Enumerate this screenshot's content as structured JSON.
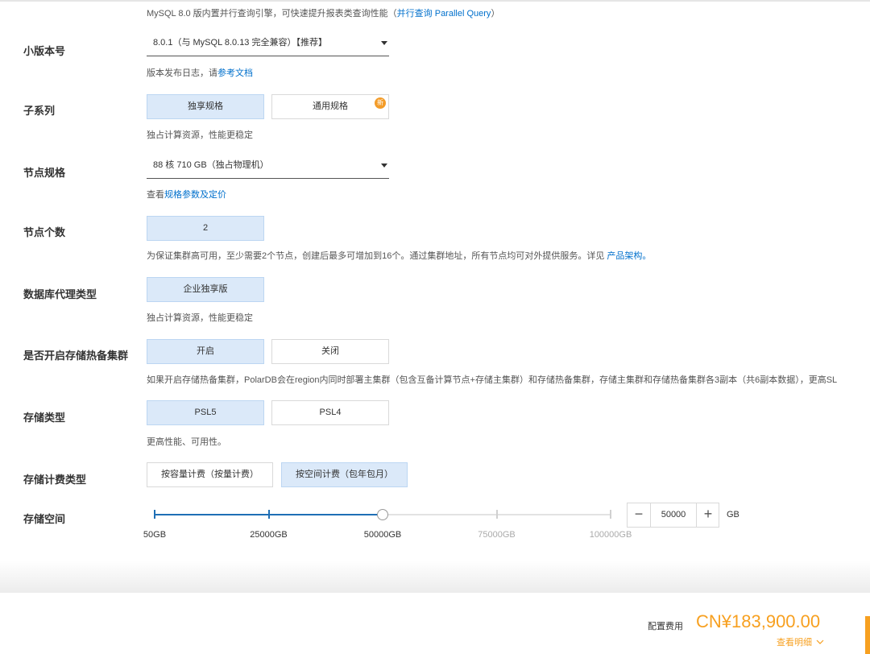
{
  "top_note": {
    "text": "MySQL 8.0 版内置并行查询引擎，可快速提升报表类查询性能（",
    "link": "并行查询 Parallel Query",
    "suffix": "）"
  },
  "minor_version": {
    "label": "小版本号",
    "value": "8.0.1（与 MySQL 8.0.13 完全兼容）【推荐】",
    "desc_prefix": "版本发布日志，请",
    "desc_link": "参考文档"
  },
  "sub_series": {
    "label": "子系列",
    "options": [
      "独享规格",
      "通用规格"
    ],
    "badge": "新",
    "selected": "独享规格",
    "desc": "独占计算资源，性能更稳定"
  },
  "node_spec": {
    "label": "节点规格",
    "value": "88 核 710 GB（独占物理机）",
    "desc_prefix": "查看",
    "desc_link": "规格参数及定价"
  },
  "node_count": {
    "label": "节点个数",
    "value": "2",
    "desc": "为保证集群高可用，至少需要2个节点，创建后最多可增加到16个。通过集群地址，所有节点均可对外提供服务。详见",
    "desc_link": "产品架构。"
  },
  "proxy_type": {
    "label": "数据库代理类型",
    "option": "企业独享版",
    "desc": "独占计算资源，性能更稳定"
  },
  "hot_standby": {
    "label": "是否开启存储热备集群",
    "options": [
      "开启",
      "关闭"
    ],
    "selected": "开启",
    "desc": "如果开启存储热备集群，PolarDB会在region内同时部署主集群（包含互备计算节点+存储主集群）和存储热备集群，存储主集群和存储热备集群各3副本（共6副本数据），更高SL"
  },
  "storage_type": {
    "label": "存储类型",
    "options": [
      "PSL5",
      "PSL4"
    ],
    "selected": "PSL5",
    "desc": "更高性能、可用性。"
  },
  "storage_billing": {
    "label": "存储计费类型",
    "options": [
      "按容量计费（按量计费）",
      "按空间计费（包年包月）"
    ],
    "selected": "按空间计费（包年包月）"
  },
  "storage_space": {
    "label": "存储空间",
    "ticks": [
      "50GB",
      "25000GB",
      "50000GB",
      "75000GB",
      "100000GB"
    ],
    "value": "50000",
    "value_fraction": 0.5,
    "unit": "GB",
    "minus": "−",
    "plus": "+"
  },
  "footer": {
    "cost_label": "配置费用",
    "cost_value": "CN¥183,900.00",
    "details": "查看明细",
    "details_icon": "chevron-down-icon"
  },
  "colors": {
    "accent": "#1f6fb5",
    "link": "#0070cc",
    "selected_bg": "#dbe9f9",
    "price": "#f7a020"
  }
}
